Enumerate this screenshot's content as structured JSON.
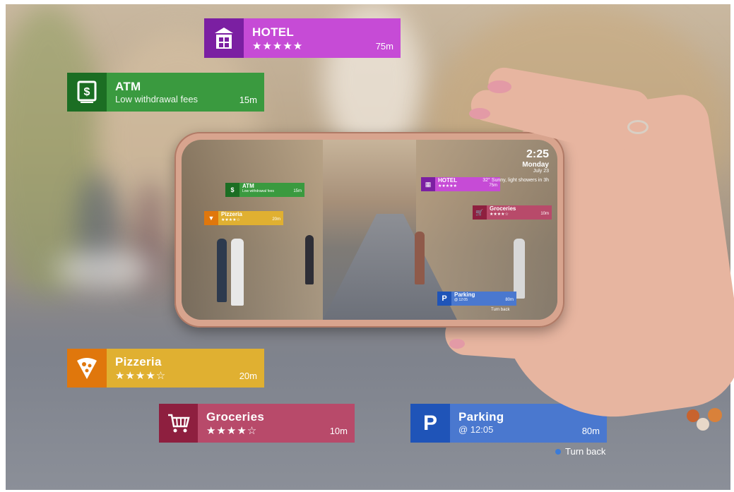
{
  "labels": {
    "hotel": {
      "title": "HOTEL",
      "stars": "★★★★★",
      "distance": "75m",
      "icon": "hotel-icon",
      "color": "#c64bd6",
      "icon_bg": "#7b1fa2"
    },
    "atm": {
      "title": "ATM",
      "subtitle": "Low withdrawal fees",
      "distance": "15m",
      "icon": "atm-icon",
      "color": "#3a9a3f",
      "icon_bg": "#1b6e23"
    },
    "pizzeria": {
      "title": "Pizzeria",
      "stars": "★★★★☆",
      "distance": "20m",
      "icon": "pizza-icon",
      "color": "#e0b031",
      "icon_bg": "#e0770c"
    },
    "groceries": {
      "title": "Groceries",
      "stars": "★★★★☆",
      "distance": "10m",
      "icon": "cart-icon",
      "color": "#b84a6a",
      "icon_bg": "#8e1f3f"
    },
    "parking": {
      "title": "Parking",
      "subtitle": "@ 12:05",
      "distance": "80m",
      "icon": "parking-icon",
      "color": "#4a78cf",
      "icon_bg": "#1f54b8"
    }
  },
  "turn_back": "Turn back",
  "phone": {
    "time": "2:25",
    "day": "Monday",
    "date": "July 23",
    "weather": "32° Sunny, light showers in 3h",
    "labels": {
      "atm": {
        "title": "ATM",
        "subtitle": "Low withdrawal fees",
        "distance": "15m"
      },
      "hotel": {
        "title": "HOTEL",
        "stars": "★★★★★",
        "distance": "75m"
      },
      "pizzeria": {
        "title": "Pizzeria",
        "stars": "★★★★☆",
        "distance": "20m"
      },
      "groceries": {
        "title": "Groceries",
        "stars": "★★★★☆",
        "distance": "10m"
      },
      "parking": {
        "title": "Parking",
        "subtitle": "@ 12:05",
        "distance": "80m"
      }
    },
    "turn_back": "Turn back"
  }
}
